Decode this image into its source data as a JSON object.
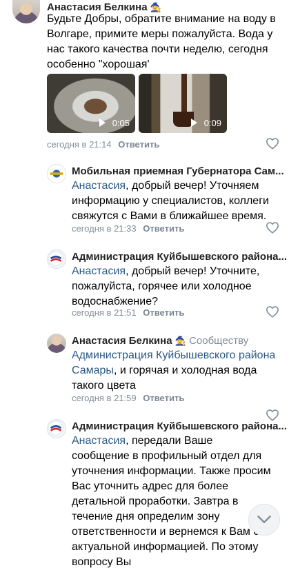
{
  "comments": [
    {
      "author": "Анастасия Белкина",
      "text": "Будьте Добры, обратите внимание на воду в Волгаре, примите меры пожалуйста. Вода у нас такого качества почти неделю, сегодня особенно \"хорошая'",
      "videos": [
        {
          "duration": "0:05"
        },
        {
          "duration": "0:09"
        }
      ],
      "time": "сегодня в 21:14",
      "reply": "Ответить"
    },
    {
      "author": "Мобильная приемная Губернатора Сам...",
      "mention": "Анастасия",
      "text": ", добрый вечер! Уточняем информацию у специалистов, коллеги свяжутся с Вами в ближайшее время.",
      "time": "сегодня в 21:33",
      "reply": "Ответить"
    },
    {
      "author": "Администрация Куйбышевского районa...",
      "mention": "Анастасия",
      "text": ", добрый вечер! Уточните, пожалуйста, горячее или холодное водоснабжение?",
      "time": "сегодня в 21:51",
      "reply": "Ответить"
    },
    {
      "author": "Анастасия Белкина",
      "target": "Сообществу",
      "mention": "Администрация Куйбышевского района Самары",
      "text": ", и горячая и холодная вода такого цвета",
      "time": "сегодня в 21:59",
      "reply": "Ответить"
    },
    {
      "author": "Администрация Куйбышевского районa...",
      "mention": "Анастасия",
      "text": ", передали Ваше сообщение в профильный отдел для уточнения информации. Также просим Вас уточнить адрес для более детальной проработки. Завтра в течение дня определим зону ответственности и вернемся к Вам с актуальной информацией. По этому вопросу Вы"
    }
  ],
  "icons": {
    "heart": "heart-outline-icon",
    "witch": "witch-hat-emoji",
    "scroll": "chevron-down-icon"
  },
  "colors": {
    "link": "#2a5885",
    "meta": "#818c99"
  }
}
